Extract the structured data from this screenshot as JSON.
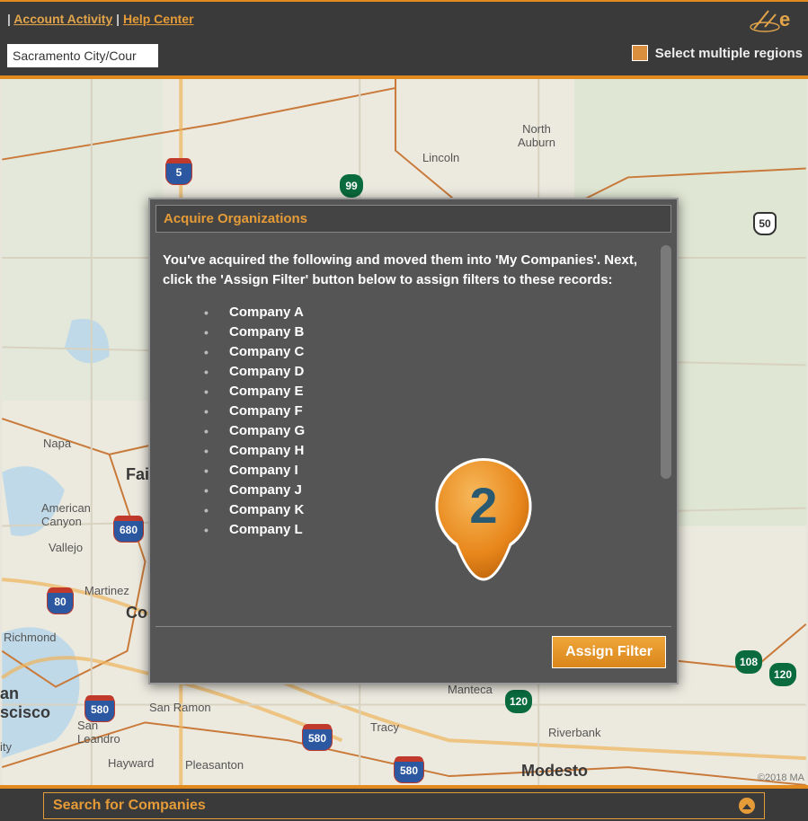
{
  "header": {
    "account_activity": "Account Activity",
    "help_center": "Help Center",
    "separator": " | ",
    "logo_letter": "e"
  },
  "toolbar": {
    "region_input_value": "Sacramento City/Cour",
    "multi_region_label": "Select multiple regions"
  },
  "modal": {
    "title": "Acquire Organizations",
    "intro": "You've acquired the following and moved them into 'My Companies'. Next, click the 'Assign Filter' button below to assign filters to these records:",
    "companies": [
      "Company A",
      "Company B",
      "Company C",
      "Company D",
      "Company E",
      "Company F",
      "Company G",
      "Company H",
      "Company I",
      "Company J",
      "Company K",
      "Company L"
    ],
    "assign_button": "Assign Filter"
  },
  "marker_number": "2",
  "search_bar": {
    "label": "Search for Companies"
  },
  "map": {
    "attribution": "©2018 MA",
    "cities": {
      "north_auburn": "North\nAuburn",
      "lincoln": "Lincoln",
      "napa": "Napa",
      "fairfield_partial": "Fai",
      "american_canyon": "American\nCanyon",
      "vallejo": "Vallejo",
      "martinez": "Martinez",
      "concord_partial": "Co",
      "richmond": "Richmond",
      "san_francisco_partial": "an\nscisco",
      "san_leandro": "San\nLeandro",
      "san_ramon": "San Ramon",
      "hayward": "Hayward",
      "pleasanton": "Pleasanton",
      "tracy": "Tracy",
      "manteca": "Manteca",
      "riverbank": "Riverbank",
      "modesto": "Modesto",
      "ity": "ity"
    },
    "highways": {
      "i5": "5",
      "sr99": "99",
      "us50": "50",
      "i680": "680",
      "i80": "80",
      "i580_a": "580",
      "i580_b": "580",
      "i580_c": "580",
      "sr108": "108",
      "sr120_a": "120",
      "sr120_b": "120"
    }
  }
}
